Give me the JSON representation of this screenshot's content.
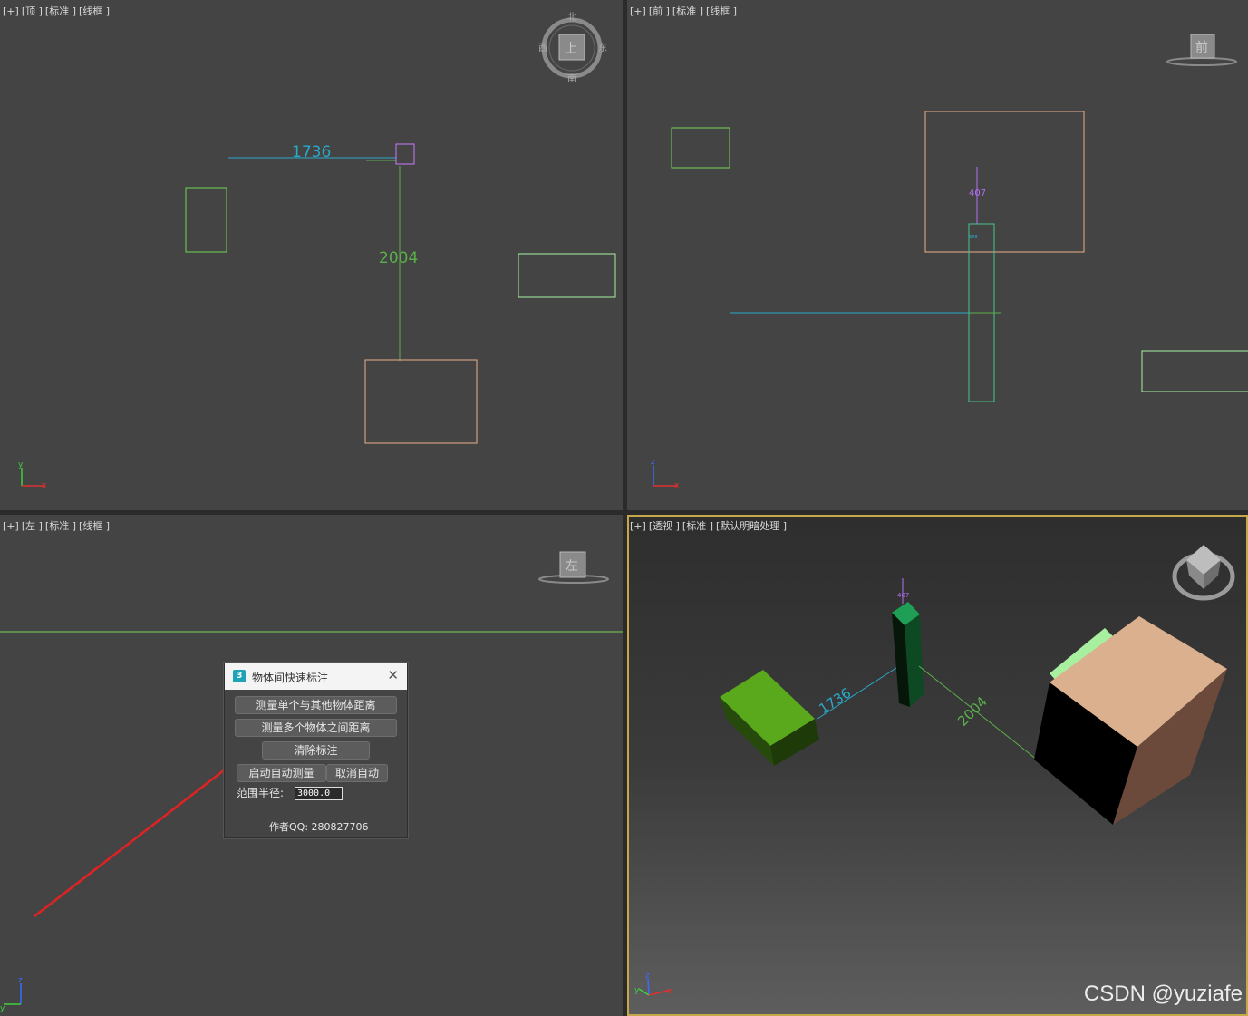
{
  "viewports": {
    "top": {
      "plus": "[+]",
      "view": "[顶 ]",
      "mode": "[标准 ]",
      "shading": "[线框 ]",
      "dim_horizontal": "1736",
      "dim_vertical": "2004",
      "viewcube": {
        "face": "上",
        "north": "北",
        "south": "南",
        "east": "东",
        "west": "西"
      },
      "axis_a": "y",
      "axis_b": "x"
    },
    "front": {
      "plus": "[+]",
      "view": "[前 ]",
      "mode": "[标准 ]",
      "shading": "[线框 ]",
      "dim_value": "407",
      "dim_small": "388",
      "viewcube": {
        "face": "前"
      },
      "axis_a": "z",
      "axis_b": "x"
    },
    "left": {
      "plus": "[+]",
      "view": "[左 ]",
      "mode": "[标准 ]",
      "shading": "[线框 ]",
      "viewcube": {
        "face": "左"
      },
      "axis_a": "z",
      "axis_b": "y"
    },
    "perspective": {
      "plus": "[+]",
      "view": "[透视 ]",
      "mode": "[标准 ]",
      "shading": "[默认明暗处理 ]",
      "dim_a": "1736",
      "dim_b": "2004",
      "dim_c": "407",
      "axis_a": "z",
      "axis_b": "y",
      "axis_c": "x"
    }
  },
  "dialog": {
    "icon": "3",
    "title": "物体间快速标注",
    "close": "✕",
    "btn_single": "测量单个与其他物体距离",
    "btn_multi": "测量多个物体之间距离",
    "btn_clear": "清除标注",
    "btn_auto_on": "启动自动测量",
    "btn_auto_off": "取消自动",
    "radius_label": "范围半径:",
    "radius_value": "3000.0",
    "author": "作者QQ: 280827706"
  },
  "colors": {
    "accent_cyan": "#2aa8c8",
    "green": "#6fd34f",
    "orange": "#e8b08a",
    "red_arrow": "#e22222"
  },
  "watermark": "CSDN @yuziafe"
}
